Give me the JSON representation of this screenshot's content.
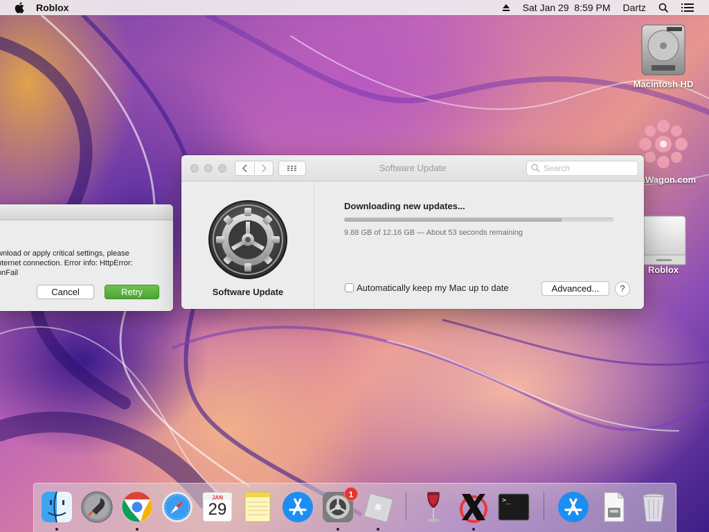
{
  "menubar": {
    "app_name": "Roblox",
    "datetime": "Sat Jan 29  8:59 PM",
    "user": "Dartz"
  },
  "desktop": {
    "icons": [
      {
        "label": "Macintosh HD",
        "icon": "hard-drive-icon"
      },
      {
        "label": "aWagon.com",
        "icon": "pink-flower-icon"
      },
      {
        "label": "Roblox",
        "icon": "disk-image-icon"
      }
    ]
  },
  "error_dialog": {
    "message_lines": [
      "wnload or apply critical settings, please",
      "nternet connection. Error info: HttpError:",
      "onFail"
    ],
    "cancel_label": "Cancel",
    "retry_label": "Retry"
  },
  "software_update": {
    "window_title": "Software Update",
    "search_placeholder": "Search",
    "pane_label": "Software Update",
    "heading": "Downloading new updates...",
    "progress_fraction": 0.81,
    "status": "9.88 GB of 12.16 GB — About 53 seconds remaining",
    "auto_update_label": "Automatically keep my Mac up to date",
    "advanced_label": "Advanced...",
    "help_label": "?"
  },
  "dock": {
    "items": [
      {
        "name": "finder-icon",
        "running": true
      },
      {
        "name": "launchpad-icon",
        "running": false
      },
      {
        "name": "chrome-icon",
        "running": true
      },
      {
        "name": "safari-icon",
        "running": false
      },
      {
        "name": "calendar-icon",
        "running": false,
        "month": "JAN",
        "day": "29"
      },
      {
        "name": "notes-icon",
        "running": false
      },
      {
        "name": "app-store-icon",
        "running": false
      },
      {
        "name": "system-preferences-icon",
        "running": true,
        "badge": "1"
      },
      {
        "name": "roblox-icon",
        "running": true
      },
      {
        "name": "wine-icon",
        "running": false
      },
      {
        "name": "x11-icon",
        "running": true
      },
      {
        "name": "terminal-icon",
        "running": false,
        "prompt": ">_"
      },
      {
        "name": "downloads-app-store-icon",
        "running": false
      },
      {
        "name": "document-icon",
        "running": false
      },
      {
        "name": "trash-icon",
        "running": false
      }
    ]
  }
}
